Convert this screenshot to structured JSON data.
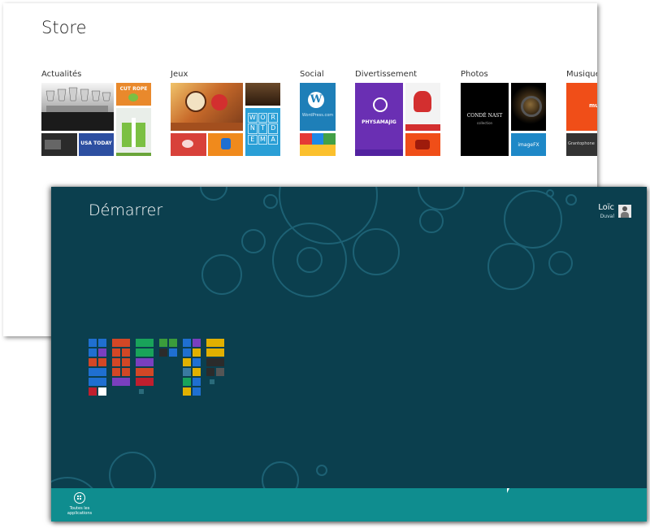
{
  "store": {
    "title": "Store",
    "categories": [
      {
        "label": "Actualités",
        "id": "actualites"
      },
      {
        "label": "Jeux",
        "id": "jeux"
      },
      {
        "label": "Social",
        "id": "social"
      },
      {
        "label": "Divertissement",
        "id": "divertissement"
      },
      {
        "label": "Photos",
        "id": "photos"
      },
      {
        "label": "Musique",
        "id": "musique"
      }
    ],
    "tile_text": {
      "cut_the_rope": "CUT ROPE",
      "usa_today": "USA TODAY",
      "word_grid": [
        "W",
        "O",
        "R",
        "N",
        "T",
        "D",
        "E",
        "M",
        "A"
      ],
      "wordpress_caption": "WordPress.com",
      "physamajig": "PHYSAMAJIG",
      "conde_nast": "CONDÉ NAST",
      "conde_nast_sub": "collection",
      "imagefx": "imageFX",
      "music_partial": "mus",
      "guitar_partial": "Grantophone"
    }
  },
  "start": {
    "title": "Démarrer",
    "user_first_name": "Loïc",
    "user_last_name": "Duval",
    "all_apps_label_line1": "Toutes les",
    "all_apps_label_line2": "applications",
    "mini_tile_colors": [
      "#1f6fd1",
      "#d24726",
      "#19a35a",
      "#3b9c3b",
      "#1f6fd1",
      "#e1b000",
      "#7a3fbf",
      "#c01f2e"
    ]
  },
  "colors": {
    "start_bg": "#0b3f4e",
    "appbar_bg": "#0f8d8f",
    "wordpress_blue": "#1e7fb8",
    "purple": "#6a2fb3",
    "orange_red": "#f04e18"
  }
}
